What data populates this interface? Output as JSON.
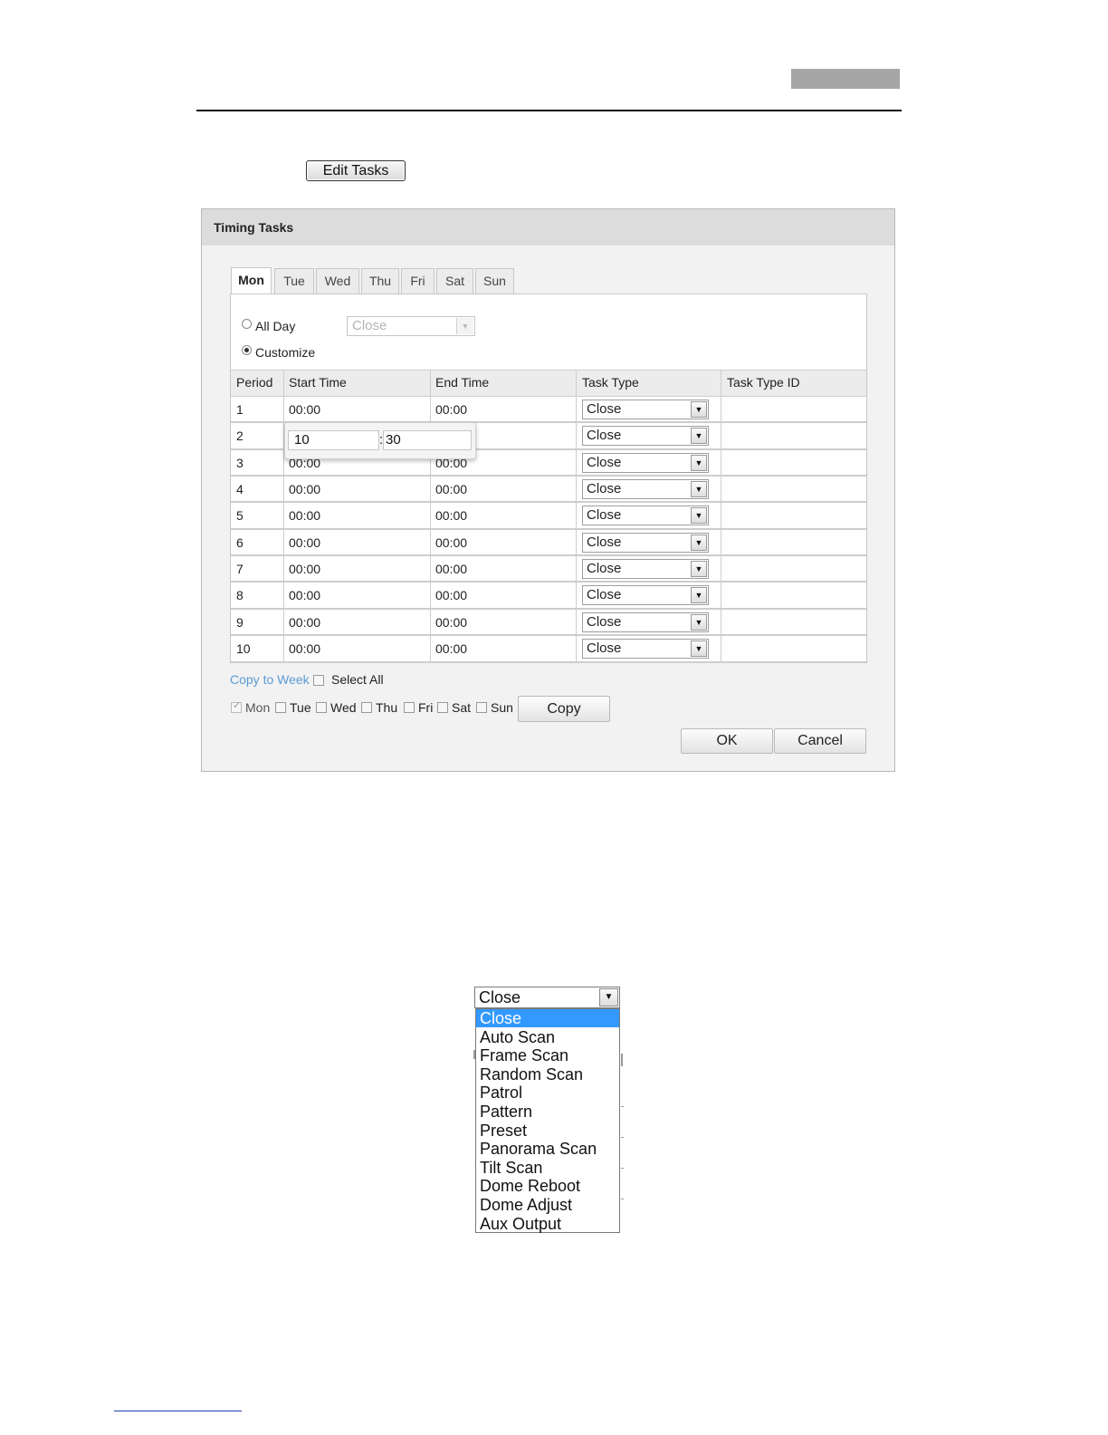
{
  "edit_tasks_button": "Edit Tasks",
  "dialog": {
    "title": "Timing Tasks",
    "tabs": [
      "Mon",
      "Tue",
      "Wed",
      "Thu",
      "Fri",
      "Sat",
      "Sun"
    ],
    "active_tab": "Mon",
    "all_day_label": "All Day",
    "all_day_select_value": "Close",
    "customize_label": "Customize",
    "selected_mode": "Customize",
    "columns": [
      "Period",
      "Start Time",
      "End Time",
      "Task Type",
      "Task Type ID"
    ],
    "rows": [
      {
        "period": "1",
        "start": "00:00",
        "end": "00:00",
        "task_type": "Close",
        "task_type_id": ""
      },
      {
        "period": "2",
        "start": "",
        "end": "",
        "task_type": "Close",
        "task_type_id": ""
      },
      {
        "period": "3",
        "start": "00:00",
        "end": "00:00",
        "task_type": "Close",
        "task_type_id": ""
      },
      {
        "period": "4",
        "start": "00:00",
        "end": "00:00",
        "task_type": "Close",
        "task_type_id": ""
      },
      {
        "period": "5",
        "start": "00:00",
        "end": "00:00",
        "task_type": "Close",
        "task_type_id": ""
      },
      {
        "period": "6",
        "start": "00:00",
        "end": "00:00",
        "task_type": "Close",
        "task_type_id": ""
      },
      {
        "period": "7",
        "start": "00:00",
        "end": "00:00",
        "task_type": "Close",
        "task_type_id": ""
      },
      {
        "period": "8",
        "start": "00:00",
        "end": "00:00",
        "task_type": "Close",
        "task_type_id": ""
      },
      {
        "period": "9",
        "start": "00:00",
        "end": "00:00",
        "task_type": "Close",
        "task_type_id": ""
      },
      {
        "period": "10",
        "start": "00:00",
        "end": "00:00",
        "task_type": "Close",
        "task_type_id": ""
      }
    ],
    "time_editor": {
      "hour": "10",
      "separator": ":",
      "minute": "30"
    },
    "copy_to_week_label": "Copy to Week",
    "select_all_label": "Select All",
    "copy_days": [
      {
        "label": "Mon",
        "checked": true
      },
      {
        "label": "Tue",
        "checked": false
      },
      {
        "label": "Wed",
        "checked": false
      },
      {
        "label": "Thu",
        "checked": false
      },
      {
        "label": "Fri",
        "checked": false
      },
      {
        "label": "Sat",
        "checked": false
      },
      {
        "label": "Sun",
        "checked": false
      }
    ],
    "copy_button": "Copy",
    "ok_button": "OK",
    "cancel_button": "Cancel"
  },
  "task_type_dropdown": {
    "selected": "Close",
    "highlighted": "Close",
    "options": [
      "Close",
      "Auto Scan",
      "Frame Scan",
      "Random Scan",
      "Patrol",
      "Pattern",
      "Preset",
      "Panorama Scan",
      "Tilt Scan",
      "Dome Reboot",
      "Dome Adjust",
      "Aux Output"
    ]
  },
  "colors": {
    "highlight": "#3399ff",
    "link": "#5a9bd6",
    "dialog_bg": "#f2f2f2",
    "header_block": "#a6a6a6"
  },
  "icons": {
    "dropdown": "▼",
    "check": "✓"
  }
}
